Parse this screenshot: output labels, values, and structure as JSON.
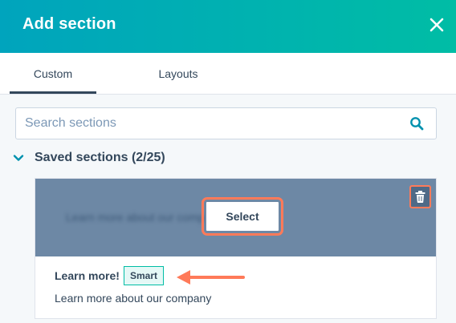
{
  "header": {
    "title": "Add section",
    "close_icon": "close-icon",
    "gradient": [
      "#00a4bd",
      "#00bda5"
    ]
  },
  "tabs": [
    {
      "label": "Custom",
      "active": true
    },
    {
      "label": "Layouts",
      "active": false
    }
  ],
  "search": {
    "placeholder": "Search sections",
    "value": "",
    "icon": "search-icon"
  },
  "saved_sections": {
    "label": "Saved sections (2/25)",
    "expanded": true,
    "icon": "chevron-down-icon",
    "items": [
      {
        "preview_text": "Learn more about our company",
        "select_label": "Select",
        "delete_icon": "trash-icon",
        "title": "Learn more!",
        "badge": "Smart",
        "description": "Learn more about our company"
      }
    ]
  },
  "colors": {
    "accent": "#00bda5",
    "text": "#33475b",
    "highlight": "#ff7a59",
    "preview_bg": "#6d88a5"
  }
}
